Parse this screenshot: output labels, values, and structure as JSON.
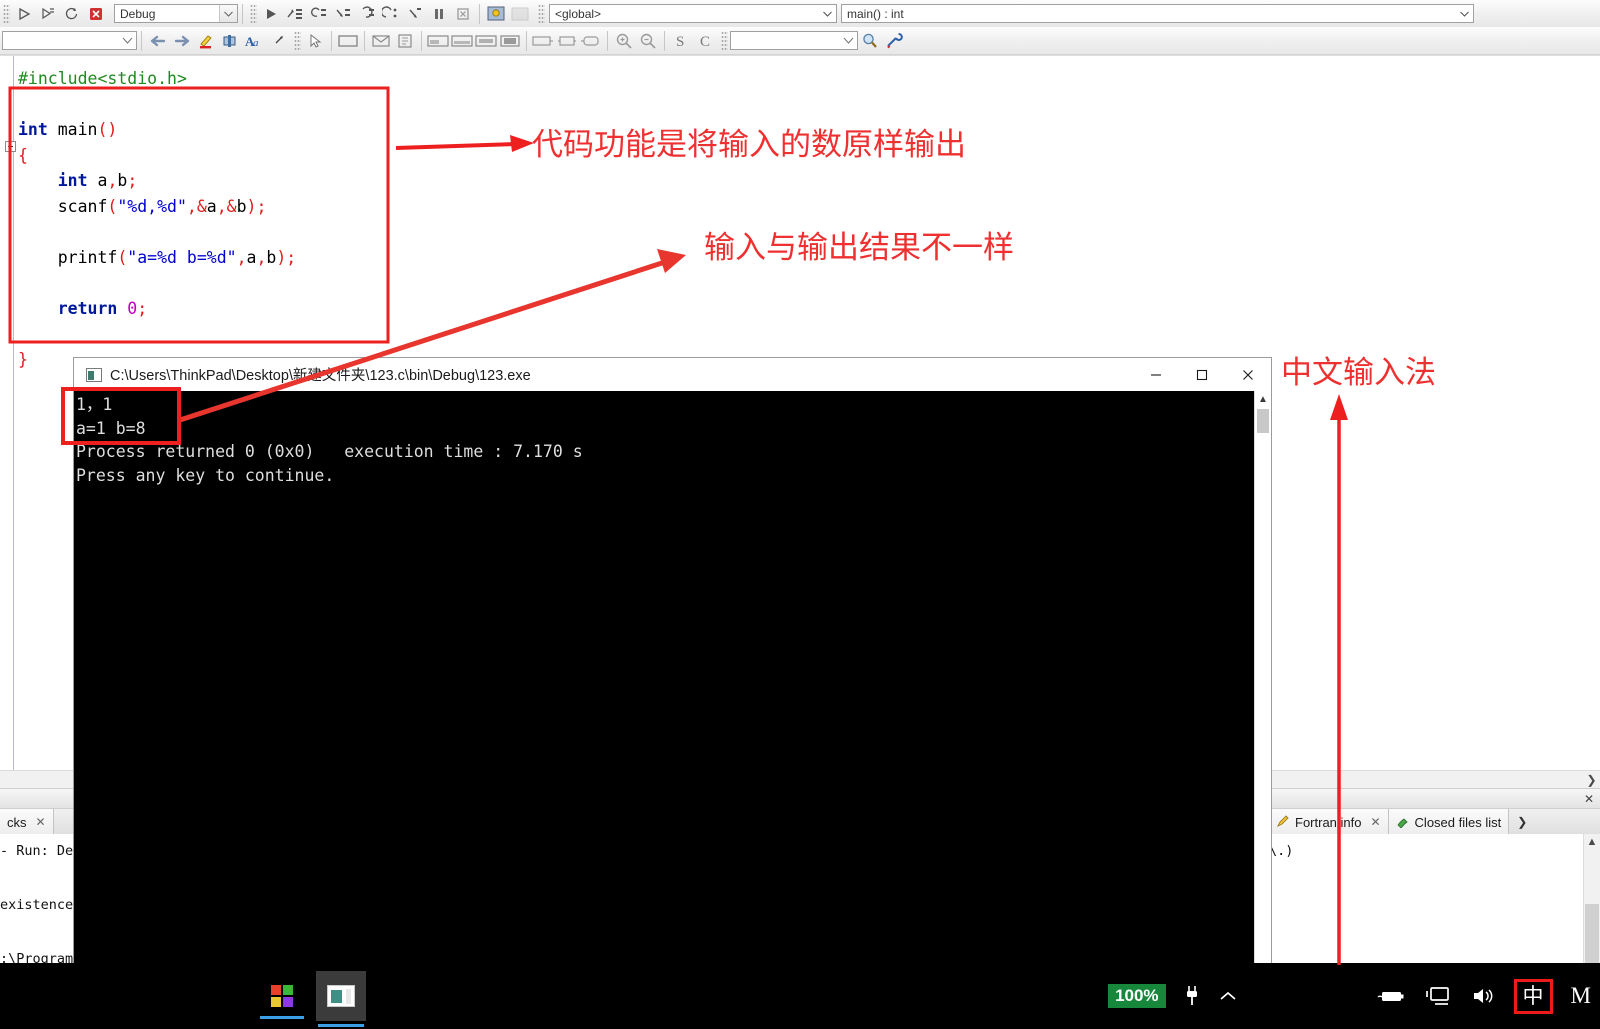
{
  "toolbar": {
    "build_target": {
      "value": "Debug",
      "name": "build-target-select"
    },
    "search_combo": {
      "value": ""
    },
    "symbol_combo": {
      "value": ""
    },
    "scope_combo": {
      "value": "<global>"
    },
    "function_combo": {
      "value": "main() : int"
    },
    "debug_buttons": [
      {
        "name": "run-button",
        "icon": "play-icon"
      },
      {
        "name": "build-run-button",
        "icon": "build-run-icon"
      },
      {
        "name": "rebuild-button",
        "icon": "rebuild-icon"
      },
      {
        "name": "abort-button",
        "icon": "stop-icon"
      }
    ],
    "row1_right_icons": [
      "debug-continue-icon",
      "step-over-icon",
      "step-into-icon",
      "step-out-icon",
      "next-instruction-icon",
      "run-to-cursor-icon",
      "break-debugger-icon",
      "stop-debugger-icon",
      "debugging-windows-icon",
      "various-info-icon"
    ],
    "row2_icons": [
      "back-icon",
      "forward-icon",
      "highlight-icon",
      "toggle-bookmark-icon",
      "find-icon",
      "goto-icon",
      "select-tool-icon",
      "frame-icon",
      "envelope-icon",
      "text-box-icon",
      "block-a-icon",
      "block-b-icon",
      "block-c-icon",
      "block-d-icon",
      "wire-a-icon",
      "wire-b-icon",
      "wire-c-icon",
      "zoom-in-icon",
      "zoom-out-icon",
      "s-letter-icon",
      "c-letter-icon",
      "find-symbol-icon",
      "tools-icon"
    ]
  },
  "editor": {
    "code_lines": [
      {
        "id": "l1",
        "text": "#include<stdio.h>"
      },
      {
        "id": "l2",
        "text": ""
      },
      {
        "id": "l3",
        "text": "int main()"
      },
      {
        "id": "l4",
        "text": "{"
      },
      {
        "id": "l5",
        "text": "    int a,b;"
      },
      {
        "id": "l6",
        "text": "    scanf(\"%d,%d\",&a,&b);"
      },
      {
        "id": "l7",
        "text": ""
      },
      {
        "id": "l8",
        "text": "    printf(\"a=%d b=%d\",a,b);"
      },
      {
        "id": "l9",
        "text": ""
      },
      {
        "id": "l10",
        "text": "    return 0;"
      },
      {
        "id": "l11",
        "text": ""
      },
      {
        "id": "l12",
        "text": "}"
      }
    ]
  },
  "console": {
    "title": "C:\\Users\\ThinkPad\\Desktop\\新建文件夹\\123.c\\bin\\Debug\\123.exe",
    "lines": [
      "1，1",
      "a=1 b=8",
      "Process returned 0 (0x0)   execution time : 7.170 s",
      "Press any key to continue."
    ],
    "window_buttons": {
      "minimize": "minimize-icon",
      "maximize": "maximize-icon",
      "close": "close-icon"
    }
  },
  "bottom_panels": {
    "left": {
      "tab_label": "cks",
      "lines": [
        "- Run: Deb",
        "",
        "existence:",
        "",
        ":\\Program"
      ]
    },
    "right": {
      "tabs": [
        {
          "label": "Fortran info",
          "icon": "pencil-icon",
          "closable": true
        },
        {
          "label": "Closed files list",
          "icon": "plug-icon",
          "closable": false
        }
      ],
      "more_arrow": "chevron-right-icon",
      "close_panel": "close-icon",
      "body_text": "\\.)"
    },
    "hscroll_arrow": "chevron-right-icon"
  },
  "annotations": [
    {
      "id": "a1",
      "text": "代码功能是将输入的数原样输出"
    },
    {
      "id": "a2",
      "text": "输入与输出结果不一样"
    },
    {
      "id": "a3",
      "text": "中文输入法"
    }
  ],
  "taskbar": {
    "start_button": "windows-start-icon",
    "apps": [
      {
        "name": "codeblocks-taskbar-item",
        "icon": "app-window-icon"
      }
    ],
    "tray": {
      "battery_percent": "100%",
      "icons": [
        "plug-icon",
        "chevron-up-icon",
        "battery-icon",
        "display-icon",
        "volume-icon"
      ],
      "ime_indicator": "中",
      "ime_label": "M"
    }
  },
  "colors": {
    "annotation_red": "#ef3030",
    "box_red": "#ee1f1f",
    "battery_green": "#17883b",
    "taskbar_black": "#000000",
    "keyword_blue": "#00189c",
    "string_blue": "#0000d0",
    "preproc_green": "#1f8a1f",
    "paren_red": "#e01b1b",
    "number_magenta": "#c000c0"
  }
}
